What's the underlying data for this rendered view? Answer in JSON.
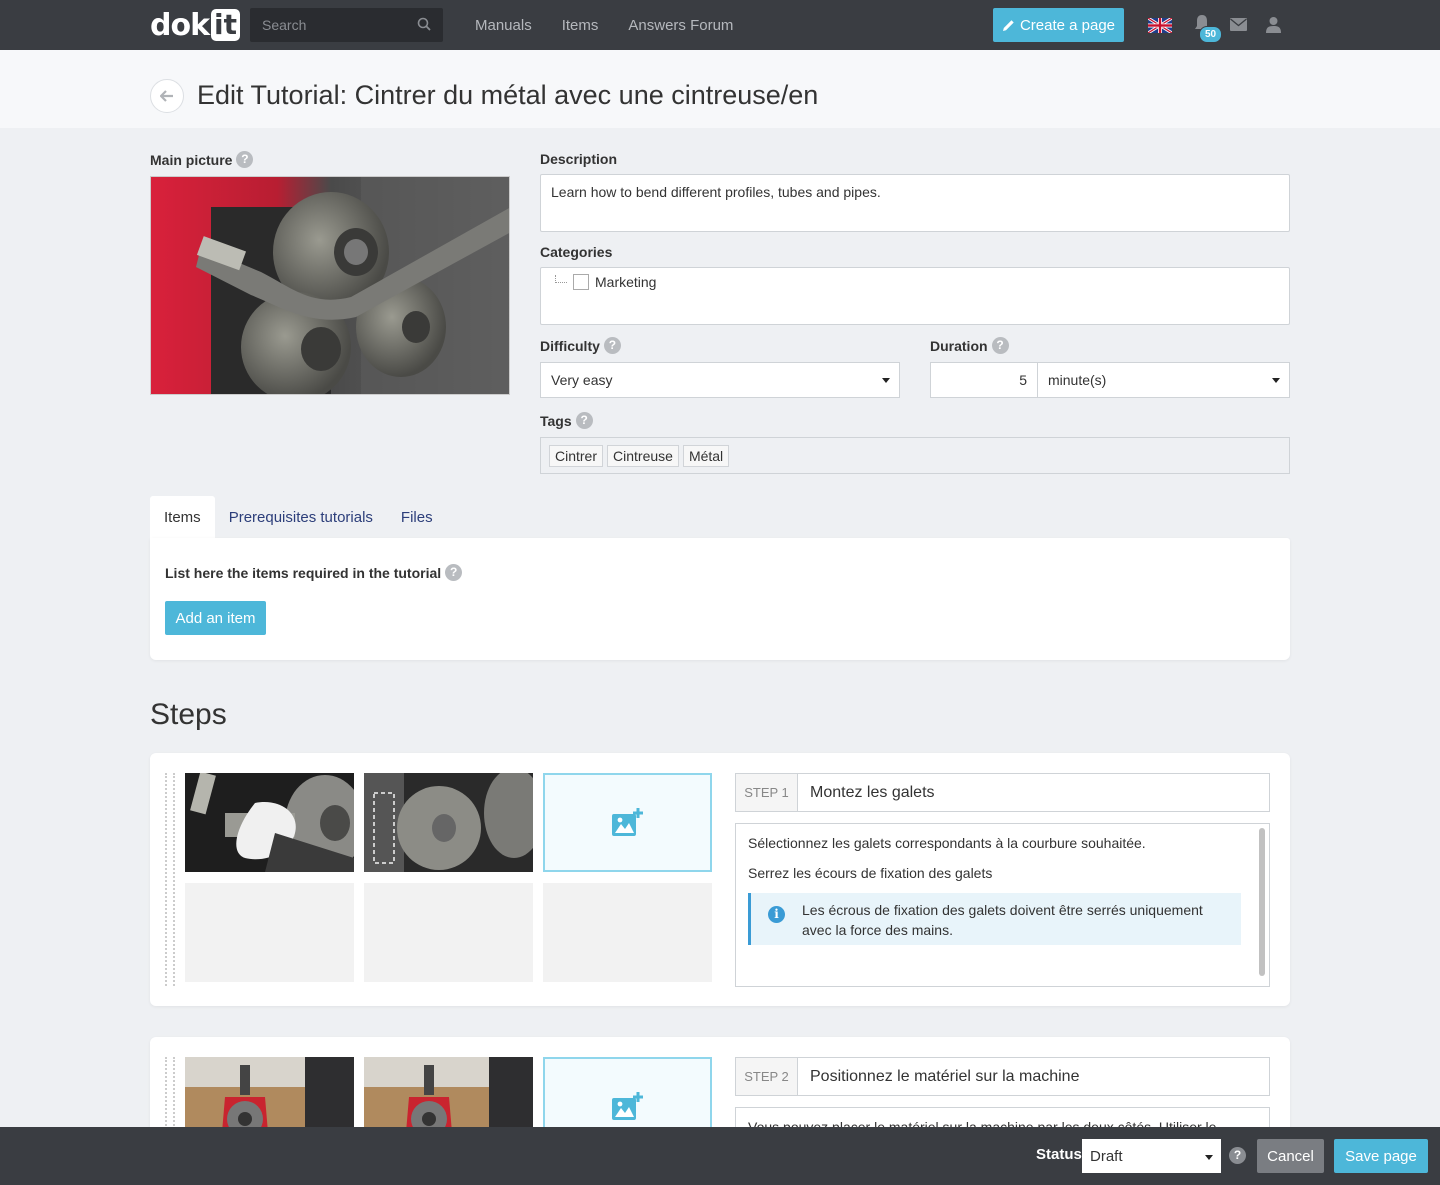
{
  "navbar": {
    "logo_left": "dok",
    "logo_right": "it",
    "search_placeholder": "Search",
    "links": [
      "Manuals",
      "Items",
      "Answers Forum"
    ],
    "create_label": "Create a page",
    "notification_count": "50",
    "accent_color": "#4db7d9",
    "bar_color": "#3a3d42"
  },
  "page": {
    "title": "Edit Tutorial: Cintrer du métal avec une cintreuse/en"
  },
  "form": {
    "main_picture_label": "Main picture",
    "description_label": "Description",
    "description_value": "Learn how to bend different profiles, tubes and pipes.",
    "categories_label": "Categories",
    "categories": [
      "Marketing"
    ],
    "difficulty_label": "Difficulty",
    "difficulty_value": "Very easy",
    "duration_label": "Duration",
    "duration_value": "5",
    "duration_unit": "minute(s)",
    "tags_label": "Tags",
    "tags": [
      "Cintrer",
      "Cintreuse",
      "Métal"
    ]
  },
  "tabs": {
    "items": [
      "Items",
      "Prerequisites tutorials",
      "Files"
    ],
    "active": "Items",
    "panel_text": "List here the items required in the tutorial",
    "add_button": "Add an item"
  },
  "steps": {
    "heading": "Steps",
    "list": [
      {
        "number_label": "STEP 1",
        "title": "Montez les galets",
        "lines": [
          "Sélectionnez les galets correspondants à la courbure souhaitée.",
          "Serrez les écours de fixation des galets"
        ],
        "info": "Les écrous de fixation des galets doivent être serrés uniquement avec la force des mains."
      },
      {
        "number_label": "STEP 2",
        "title": "Positionnez le matériel sur la machine",
        "lines": [
          "Vous pouvez placer le matériel sur la machine par les deux côtés. Utiliser le"
        ]
      }
    ]
  },
  "bottombar": {
    "status_label": "Status",
    "status_value": "Draft",
    "cancel_label": "Cancel",
    "save_label": "Save page"
  },
  "icons": {
    "search": "search-icon",
    "pencil": "pencil-icon",
    "flag": "uk-flag-icon",
    "bell": "bell-icon",
    "mail": "mail-icon",
    "user": "user-icon",
    "back": "arrow-left-icon",
    "help": "question-icon",
    "add_image": "add-image-icon",
    "info": "info-icon"
  }
}
